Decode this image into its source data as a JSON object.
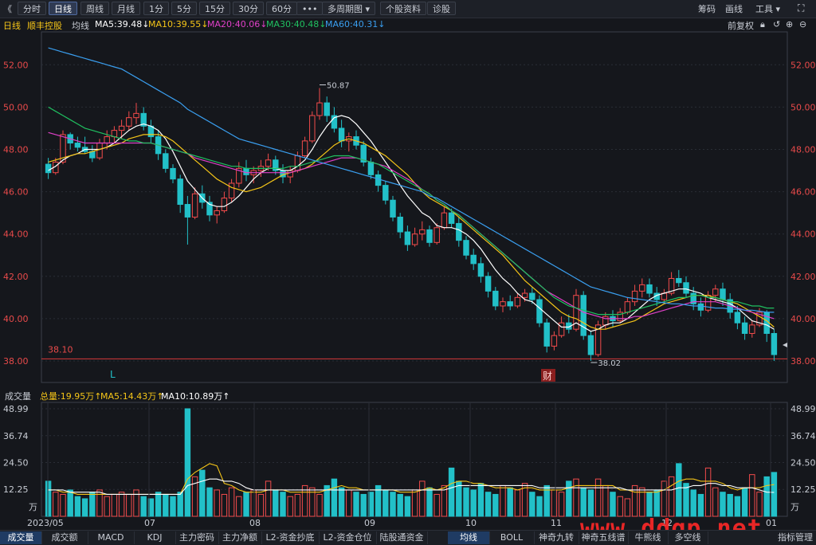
{
  "toolbar": {
    "back": "《",
    "buttons": [
      "分时",
      "日线",
      "周线",
      "月线",
      "1分",
      "5分",
      "15分",
      "30分",
      "60分",
      "•••",
      "多周期图 ▾",
      "个股资料",
      "诊股"
    ],
    "active_index": 1,
    "right": [
      "筹码",
      "画线",
      "工具 ▾"
    ]
  },
  "ma_bar": {
    "period": "日线",
    "stock_name": "顺丰控股",
    "mode": "均线",
    "ma5": "MA5:39.48↓",
    "ma10": "MA10:39.55↓",
    "ma20": "MA20:40.06↓",
    "ma30": "MA30:40.48↓",
    "ma60": "MA60:40.31↓",
    "fuquan": "前复权",
    "colors": {
      "ma5": "#ffffff",
      "ma10": "#f5c518",
      "ma20": "#e040c8",
      "ma30": "#20c060",
      "ma60": "#3a9ff0"
    }
  },
  "price_axis_labels": [
    "52.00",
    "50.00",
    "48.00",
    "46.00",
    "44.00",
    "42.00",
    "40.00",
    "38.00"
  ],
  "annotations": {
    "high_label": "50.87",
    "low_label": "38.02",
    "ref_line_label": "38.10",
    "l_marker": "L",
    "cai_marker": "财"
  },
  "volume_bar": {
    "title": "成交量",
    "total": "总量:19.95万↑",
    "ma5": "MA5:14.43万↑",
    "ma10": "MA10:10.89万↑",
    "axis_labels": [
      "48.99",
      "36.74",
      "24.50",
      "12.25",
      "万"
    ]
  },
  "date_labels": [
    "2023/05",
    "07",
    "08",
    "09",
    "10",
    "11",
    "12",
    "01"
  ],
  "bottom_tabs_left": [
    "成交量",
    "成交额",
    "MACD",
    "KDJ",
    "主力密码",
    "主力净额",
    "L2-资金抄底",
    "L2-资金仓位",
    "陆股通资金"
  ],
  "bottom_tabs_right": [
    "均线",
    "BOLL",
    "神奇九转",
    "神奇五线谱",
    "牛熊线",
    "多空线",
    "指标管理"
  ],
  "watermark": "www.ddgp.net",
  "chart_data": {
    "type": "candlestick",
    "title": "顺丰控股 日线",
    "xlabel": "",
    "ylabel": "",
    "ylim": [
      37.8,
      53.0
    ],
    "up_color": "#f24b4b",
    "down_color": "#22c0c8",
    "candles_ohlc": [
      [
        47.3,
        47.6,
        46.6,
        46.9
      ],
      [
        46.9,
        47.6,
        46.8,
        47.4
      ],
      [
        47.4,
        48.9,
        47.3,
        48.7
      ],
      [
        48.7,
        48.8,
        48.0,
        48.3
      ],
      [
        48.3,
        48.6,
        47.9,
        48.1
      ],
      [
        48.1,
        48.6,
        47.8,
        47.9
      ],
      [
        47.9,
        48.2,
        47.4,
        47.6
      ],
      [
        47.6,
        48.5,
        47.5,
        48.3
      ],
      [
        48.3,
        48.9,
        48.0,
        48.6
      ],
      [
        48.6,
        49.1,
        48.3,
        48.9
      ],
      [
        48.9,
        49.4,
        48.5,
        49.1
      ],
      [
        49.1,
        49.8,
        48.9,
        49.5
      ],
      [
        49.5,
        50.2,
        49.2,
        49.7
      ],
      [
        49.7,
        50.0,
        48.9,
        49.1
      ],
      [
        49.1,
        49.4,
        48.3,
        48.6
      ],
      [
        48.6,
        48.9,
        47.5,
        47.8
      ],
      [
        47.8,
        48.0,
        46.9,
        47.1
      ],
      [
        47.1,
        47.3,
        46.4,
        46.6
      ],
      [
        46.6,
        46.8,
        45.0,
        45.4
      ],
      [
        45.4,
        45.8,
        43.5,
        44.8
      ],
      [
        44.8,
        46.2,
        44.7,
        45.9
      ],
      [
        45.9,
        46.3,
        45.2,
        45.5
      ],
      [
        45.5,
        45.8,
        44.6,
        44.9
      ],
      [
        44.9,
        45.3,
        44.5,
        45.1
      ],
      [
        45.1,
        46.0,
        45.0,
        45.7
      ],
      [
        45.7,
        46.6,
        45.5,
        46.4
      ],
      [
        46.4,
        47.4,
        46.2,
        47.1
      ],
      [
        47.1,
        47.5,
        46.5,
        46.8
      ],
      [
        46.8,
        47.2,
        46.4,
        47.0
      ],
      [
        47.0,
        47.5,
        46.7,
        47.2
      ],
      [
        47.2,
        47.8,
        47.0,
        47.5
      ],
      [
        47.5,
        47.7,
        46.8,
        47.0
      ],
      [
        47.0,
        47.3,
        46.4,
        46.7
      ],
      [
        46.7,
        47.2,
        46.4,
        47.0
      ],
      [
        47.0,
        47.9,
        46.9,
        47.7
      ],
      [
        47.7,
        48.6,
        47.6,
        48.4
      ],
      [
        48.4,
        49.8,
        48.3,
        49.6
      ],
      [
        49.6,
        50.9,
        49.4,
        50.2
      ],
      [
        50.2,
        50.5,
        49.3,
        49.6
      ],
      [
        49.6,
        50.0,
        48.8,
        49.0
      ],
      [
        49.0,
        49.4,
        48.1,
        48.4
      ],
      [
        48.4,
        48.8,
        47.9,
        48.6
      ],
      [
        48.6,
        48.9,
        48.0,
        48.2
      ],
      [
        48.2,
        48.4,
        47.2,
        47.4
      ],
      [
        47.4,
        47.6,
        46.6,
        46.8
      ],
      [
        46.8,
        47.0,
        46.0,
        46.3
      ],
      [
        46.3,
        46.5,
        45.4,
        45.6
      ],
      [
        45.6,
        45.8,
        44.6,
        44.8
      ],
      [
        44.8,
        45.0,
        43.8,
        44.1
      ],
      [
        44.1,
        44.4,
        43.2,
        43.5
      ],
      [
        43.5,
        44.3,
        43.4,
        44.0
      ],
      [
        44.0,
        44.6,
        43.7,
        44.2
      ],
      [
        44.2,
        44.4,
        43.4,
        43.6
      ],
      [
        43.6,
        44.5,
        43.5,
        44.3
      ],
      [
        44.3,
        45.3,
        44.2,
        45.0
      ],
      [
        45.0,
        45.2,
        44.3,
        44.5
      ],
      [
        44.5,
        44.8,
        43.4,
        43.7
      ],
      [
        43.7,
        43.9,
        42.8,
        43.0
      ],
      [
        43.0,
        43.3,
        42.3,
        42.6
      ],
      [
        42.6,
        42.9,
        41.7,
        42.0
      ],
      [
        42.0,
        42.2,
        41.0,
        41.3
      ],
      [
        41.3,
        41.5,
        40.4,
        40.6
      ],
      [
        40.6,
        41.0,
        40.3,
        40.8
      ],
      [
        40.8,
        41.1,
        40.4,
        40.6
      ],
      [
        40.6,
        41.2,
        40.5,
        41.0
      ],
      [
        41.0,
        41.4,
        40.8,
        41.2
      ],
      [
        41.2,
        41.5,
        40.7,
        40.9
      ],
      [
        40.9,
        41.1,
        39.6,
        39.8
      ],
      [
        39.8,
        40.0,
        38.4,
        38.7
      ],
      [
        38.7,
        39.4,
        38.5,
        39.2
      ],
      [
        39.2,
        40.1,
        39.1,
        39.8
      ],
      [
        39.8,
        40.2,
        39.3,
        39.5
      ],
      [
        39.5,
        41.4,
        39.4,
        41.1
      ],
      [
        41.1,
        41.3,
        39.0,
        39.2
      ],
      [
        39.2,
        39.4,
        38.0,
        38.3
      ],
      [
        38.3,
        39.9,
        38.2,
        39.7
      ],
      [
        39.7,
        40.3,
        39.5,
        40.1
      ],
      [
        40.1,
        40.4,
        39.6,
        39.9
      ],
      [
        39.9,
        40.5,
        39.8,
        40.3
      ],
      [
        40.3,
        41.0,
        40.2,
        40.8
      ],
      [
        40.8,
        41.6,
        40.6,
        41.3
      ],
      [
        41.3,
        41.9,
        41.0,
        41.6
      ],
      [
        41.6,
        41.9,
        41.0,
        41.2
      ],
      [
        41.2,
        41.5,
        40.6,
        40.9
      ],
      [
        40.9,
        41.4,
        40.7,
        41.2
      ],
      [
        41.2,
        42.2,
        41.1,
        41.9
      ],
      [
        41.9,
        42.3,
        41.5,
        41.7
      ],
      [
        41.7,
        42.0,
        41.0,
        41.2
      ],
      [
        41.2,
        41.5,
        40.4,
        40.7
      ],
      [
        40.7,
        41.0,
        40.1,
        40.4
      ],
      [
        40.4,
        41.3,
        40.3,
        41.1
      ],
      [
        41.1,
        41.6,
        40.8,
        41.4
      ],
      [
        41.4,
        41.7,
        40.6,
        40.9
      ],
      [
        40.9,
        41.2,
        40.0,
        40.3
      ],
      [
        40.3,
        40.6,
        39.5,
        39.8
      ],
      [
        39.8,
        40.1,
        39.0,
        39.3
      ],
      [
        39.3,
        39.9,
        39.1,
        39.7
      ],
      [
        39.7,
        40.5,
        39.6,
        40.3
      ],
      [
        40.3,
        40.4,
        38.9,
        39.3
      ],
      [
        39.3,
        39.5,
        38.0,
        38.3
      ]
    ],
    "ma_series": {
      "ma5": [
        47.0,
        47.2,
        47.5,
        47.7,
        47.8,
        48.0,
        48.0,
        48.0,
        48.1,
        48.3,
        48.6,
        48.9,
        49.1,
        49.2,
        49.1,
        48.9,
        48.5,
        47.9,
        47.2,
        46.5,
        46.1,
        45.7,
        45.4,
        45.3,
        45.3,
        45.5,
        45.8,
        46.2,
        46.6,
        46.9,
        47.1,
        47.1,
        47.0,
        47.0,
        47.2,
        47.5,
        48.0,
        48.6,
        49.1,
        49.5,
        49.6,
        49.5,
        49.2,
        48.8,
        48.4,
        47.9,
        47.4,
        46.9,
        46.3,
        45.8,
        45.4,
        45.0,
        44.8,
        44.4,
        44.3,
        44.3,
        44.2,
        44.0,
        43.7,
        43.3,
        42.8,
        42.3,
        41.9,
        41.6,
        41.2,
        40.9,
        40.8,
        40.5,
        40.2,
        39.9,
        39.6,
        39.6,
        39.8,
        39.6,
        39.4,
        39.5,
        39.7,
        39.8,
        39.8,
        40.0,
        40.3,
        40.6,
        40.9,
        41.1,
        41.2,
        41.3,
        41.4,
        41.4,
        41.3,
        41.2,
        41.0,
        40.9,
        40.8,
        40.7,
        40.5,
        40.2,
        39.9,
        39.8,
        39.7,
        39.5
      ],
      "ma10": [
        47.4,
        47.5,
        47.6,
        47.7,
        47.8,
        47.8,
        47.9,
        48.0,
        48.1,
        48.2,
        48.3,
        48.5,
        48.6,
        48.7,
        48.7,
        48.7,
        48.6,
        48.4,
        48.1,
        47.8,
        47.5,
        47.2,
        46.9,
        46.6,
        46.4,
        46.2,
        46.1,
        46.0,
        46.1,
        46.2,
        46.4,
        46.6,
        46.8,
        46.9,
        47.0,
        47.1,
        47.3,
        47.6,
        47.9,
        48.2,
        48.4,
        48.5,
        48.4,
        48.3,
        48.1,
        47.9,
        47.7,
        47.4,
        47.1,
        46.8,
        46.4,
        46.0,
        45.7,
        45.5,
        45.3,
        45.1,
        44.8,
        44.5,
        44.2,
        43.9,
        43.6,
        43.3,
        43.0,
        42.6,
        42.2,
        41.8,
        41.5,
        41.2,
        40.9,
        40.6,
        40.3,
        40.1,
        40.0,
        39.8,
        39.6,
        39.5,
        39.5,
        39.6,
        39.7,
        39.8,
        39.9,
        40.1,
        40.3,
        40.5,
        40.7,
        40.8,
        40.9,
        41.0,
        41.1,
        41.1,
        41.1,
        41.0,
        40.9,
        40.8,
        40.7,
        40.5,
        40.3,
        40.1,
        39.9,
        39.6
      ],
      "ma20": [
        48.8,
        48.7,
        48.6,
        48.5,
        48.4,
        48.3,
        48.3,
        48.3,
        48.3,
        48.3,
        48.3,
        48.3,
        48.3,
        48.3,
        48.3,
        48.2,
        48.1,
        48.0,
        47.9,
        47.8,
        47.6,
        47.5,
        47.4,
        47.3,
        47.2,
        47.1,
        47.0,
        46.9,
        46.9,
        46.9,
        46.9,
        46.9,
        46.9,
        46.9,
        47.0,
        47.1,
        47.2,
        47.3,
        47.4,
        47.5,
        47.6,
        47.6,
        47.6,
        47.5,
        47.4,
        47.3,
        47.2,
        47.0,
        46.8,
        46.6,
        46.4,
        46.1,
        45.9,
        45.6,
        45.4,
        45.1,
        44.9,
        44.6,
        44.3,
        44.0,
        43.7,
        43.4,
        43.1,
        42.8,
        42.5,
        42.2,
        41.9,
        41.6,
        41.3,
        41.1,
        40.9,
        40.7,
        40.5,
        40.3,
        40.2,
        40.1,
        40.0,
        40.0,
        40.0,
        40.0,
        40.1,
        40.1,
        40.2,
        40.3,
        40.4,
        40.5,
        40.6,
        40.7,
        40.8,
        40.8,
        40.8,
        40.8,
        40.7,
        40.6,
        40.5,
        40.4,
        40.3,
        40.2,
        40.1,
        40.0
      ],
      "ma30": [
        50.0,
        49.8,
        49.6,
        49.4,
        49.2,
        49.0,
        48.9,
        48.8,
        48.7,
        48.6,
        48.5,
        48.4,
        48.4,
        48.3,
        48.3,
        48.2,
        48.1,
        48.0,
        47.9,
        47.8,
        47.7,
        47.6,
        47.5,
        47.4,
        47.3,
        47.2,
        47.2,
        47.1,
        47.1,
        47.1,
        47.1,
        47.1,
        47.1,
        47.2,
        47.2,
        47.3,
        47.4,
        47.5,
        47.6,
        47.7,
        47.7,
        47.7,
        47.6,
        47.5,
        47.4,
        47.3,
        47.1,
        46.9,
        46.7,
        46.5,
        46.3,
        46.1,
        45.9,
        45.6,
        45.4,
        45.1,
        44.9,
        44.6,
        44.3,
        44.0,
        43.7,
        43.4,
        43.1,
        42.8,
        42.5,
        42.2,
        41.9,
        41.6,
        41.3,
        41.0,
        40.8,
        40.6,
        40.5,
        40.4,
        40.3,
        40.2,
        40.2,
        40.2,
        40.2,
        40.3,
        40.4,
        40.5,
        40.6,
        40.7,
        40.8,
        40.9,
        41.0,
        41.0,
        41.1,
        41.1,
        41.0,
        41.0,
        40.9,
        40.8,
        40.8,
        40.7,
        40.6,
        40.6,
        40.5,
        40.5
      ],
      "ma60": [
        52.8,
        52.7,
        52.6,
        52.5,
        52.4,
        52.3,
        52.2,
        52.1,
        52.0,
        51.9,
        51.8,
        51.6,
        51.4,
        51.2,
        51.0,
        50.8,
        50.6,
        50.4,
        50.2,
        49.9,
        49.7,
        49.5,
        49.3,
        49.1,
        48.9,
        48.7,
        48.5,
        48.4,
        48.3,
        48.2,
        48.1,
        48.0,
        47.9,
        47.8,
        47.7,
        47.6,
        47.5,
        47.4,
        47.3,
        47.2,
        47.1,
        47.0,
        46.9,
        46.8,
        46.7,
        46.6,
        46.5,
        46.4,
        46.3,
        46.2,
        46.1,
        46.0,
        45.8,
        45.7,
        45.5,
        45.3,
        45.1,
        44.9,
        44.7,
        44.5,
        44.3,
        44.1,
        43.9,
        43.7,
        43.5,
        43.3,
        43.1,
        42.9,
        42.7,
        42.5,
        42.3,
        42.1,
        41.9,
        41.7,
        41.5,
        41.4,
        41.3,
        41.2,
        41.1,
        41.0,
        40.95,
        40.9,
        40.85,
        40.8,
        40.75,
        40.7,
        40.7,
        40.65,
        40.6,
        40.6,
        40.55,
        40.5,
        40.5,
        40.45,
        40.45,
        40.4,
        40.4,
        40.35,
        40.3,
        40.3
      ]
    },
    "volume": {
      "ylim": [
        0,
        48.99
      ],
      "values": [
        16,
        11,
        10,
        12,
        9,
        8,
        11,
        12,
        9,
        10,
        11,
        10,
        12,
        9,
        8,
        11,
        10,
        9,
        11,
        48.99,
        18,
        21,
        13,
        12,
        10,
        13,
        9,
        11,
        12,
        10,
        16,
        12,
        11,
        9,
        10,
        14,
        13,
        10,
        14,
        17,
        13,
        12,
        11,
        10,
        11,
        14,
        12,
        11,
        10,
        9,
        12,
        16,
        13,
        10,
        14,
        22,
        16,
        13,
        12,
        15,
        11,
        10,
        14,
        13,
        12,
        15,
        11,
        9,
        14,
        12,
        11,
        16,
        17,
        13,
        12,
        17,
        14,
        11,
        9,
        8,
        14,
        13,
        11,
        12,
        16,
        18,
        24,
        15,
        12,
        10,
        22,
        13,
        11,
        10,
        9,
        13,
        19,
        11,
        18,
        20
      ],
      "ma5": [
        12,
        12,
        11,
        11,
        10,
        10,
        10,
        10,
        10,
        10,
        10,
        10,
        10,
        10,
        10,
        10,
        10,
        10,
        10,
        17,
        20,
        22,
        24,
        23,
        15,
        14,
        12,
        11,
        11,
        11,
        12,
        12,
        12,
        11,
        11,
        11,
        11,
        11,
        12,
        13,
        14,
        13,
        13,
        12,
        12,
        12,
        12,
        12,
        11,
        11,
        11,
        12,
        13,
        12,
        13,
        15,
        16,
        16,
        15,
        15,
        14,
        13,
        13,
        13,
        12,
        13,
        13,
        12,
        12,
        12,
        12,
        13,
        14,
        14,
        14,
        14,
        14,
        14,
        12,
        12,
        11,
        11,
        11,
        11,
        12,
        14,
        16,
        17,
        17,
        16,
        16,
        16,
        15,
        13,
        12,
        13,
        13,
        13,
        14,
        14.43
      ],
      "ma10": [
        12,
        12,
        12,
        11,
        11,
        11,
        11,
        11,
        10,
        10,
        10,
        10,
        10,
        10,
        10,
        10,
        10,
        10,
        10,
        14,
        15,
        16,
        17,
        17,
        16,
        16,
        15,
        13,
        12,
        12,
        12,
        12,
        12,
        12,
        12,
        12,
        12,
        12,
        12,
        12,
        12,
        12,
        12,
        12,
        12,
        12,
        12,
        12,
        12,
        12,
        12,
        12,
        12,
        12,
        12,
        13,
        14,
        14,
        14,
        14,
        14,
        14,
        14,
        14,
        14,
        14,
        14,
        13,
        13,
        13,
        13,
        13,
        13,
        13,
        13,
        13,
        13,
        13,
        13,
        12,
        12,
        12,
        12,
        12,
        12,
        12,
        13,
        13,
        14,
        14,
        15,
        15,
        14,
        14,
        13,
        13,
        13,
        12,
        11,
        10.89
      ]
    },
    "ref_line_value": 38.1,
    "high": 50.87,
    "low": 38.02
  }
}
